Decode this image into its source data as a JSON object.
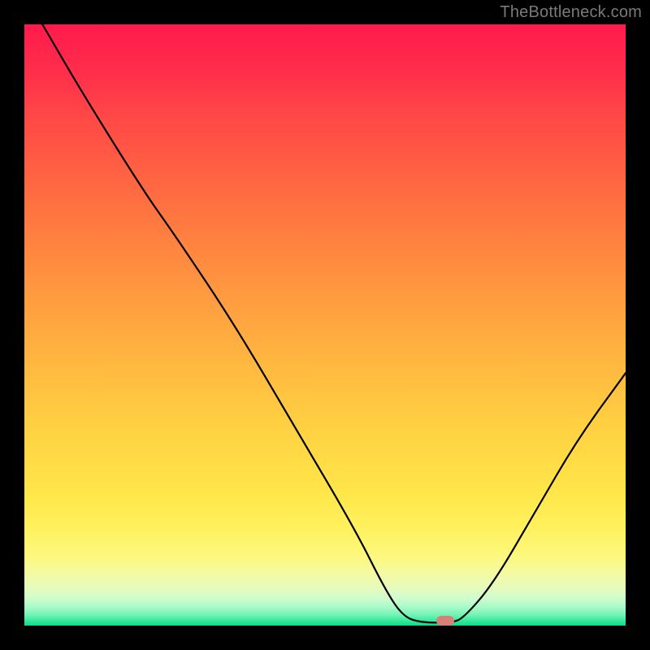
{
  "watermark": "TheBottleneck.com",
  "chart_data": {
    "type": "line",
    "title": "",
    "xlabel": "",
    "ylabel": "",
    "xlim": [
      0,
      100
    ],
    "ylim": [
      0,
      100
    ],
    "grid": false,
    "legend": false,
    "curve": [
      {
        "x": 3,
        "y": 100
      },
      {
        "x": 10,
        "y": 88
      },
      {
        "x": 20,
        "y": 72
      },
      {
        "x": 25,
        "y": 65
      },
      {
        "x": 35,
        "y": 50
      },
      {
        "x": 45,
        "y": 33
      },
      {
        "x": 55,
        "y": 16
      },
      {
        "x": 60,
        "y": 6
      },
      {
        "x": 63,
        "y": 1.5
      },
      {
        "x": 66,
        "y": 0.5
      },
      {
        "x": 71,
        "y": 0.5
      },
      {
        "x": 73,
        "y": 1.2
      },
      {
        "x": 78,
        "y": 7
      },
      {
        "x": 85,
        "y": 19
      },
      {
        "x": 92,
        "y": 31
      },
      {
        "x": 100,
        "y": 42
      }
    ],
    "marker": {
      "x": 70,
      "y": 0.8,
      "color": "#d88076"
    },
    "gradient_stops": [
      {
        "pos": 0,
        "color": "#ff1a4d"
      },
      {
        "pos": 0.5,
        "color": "#ffa740"
      },
      {
        "pos": 0.85,
        "color": "#fff05a"
      },
      {
        "pos": 1.0,
        "color": "#0fd985"
      }
    ]
  }
}
